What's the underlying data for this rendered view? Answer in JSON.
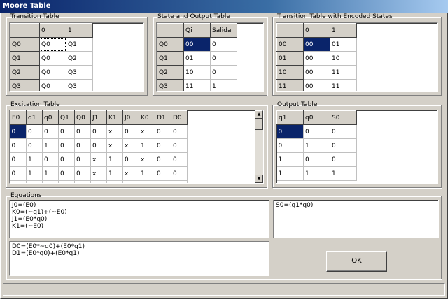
{
  "window": {
    "title": "Moore Table"
  },
  "transition_table": {
    "title": "Transition Table",
    "headers": [
      "",
      "0",
      "1"
    ],
    "rows": [
      [
        "Q0",
        "Q0",
        "Q1"
      ],
      [
        "Q1",
        "Q0",
        "Q2"
      ],
      [
        "Q2",
        "Q0",
        "Q3"
      ],
      [
        "Q3",
        "Q0",
        "Q3"
      ]
    ]
  },
  "state_output_table": {
    "title": "State and Output Table",
    "headers": [
      "",
      "Qi",
      "Salida"
    ],
    "rows": [
      [
        "Q0",
        "00",
        "0"
      ],
      [
        "Q1",
        "01",
        "0"
      ],
      [
        "Q2",
        "10",
        "0"
      ],
      [
        "Q3",
        "11",
        "1"
      ]
    ]
  },
  "encoded_table": {
    "title": "Transition Table with Encoded States",
    "headers": [
      "",
      "0",
      "1"
    ],
    "rows": [
      [
        "00",
        "00",
        "01"
      ],
      [
        "01",
        "00",
        "10"
      ],
      [
        "10",
        "00",
        "11"
      ],
      [
        "11",
        "00",
        "11"
      ]
    ]
  },
  "excitation_table": {
    "title": "Excitation Table",
    "headers": [
      "E0",
      "q1",
      "q0",
      "Q1",
      "Q0",
      "J1",
      "K1",
      "J0",
      "K0",
      "D1",
      "D0"
    ],
    "rows": [
      [
        "0",
        "0",
        "0",
        "0",
        "0",
        "0",
        "x",
        "0",
        "x",
        "0",
        "0"
      ],
      [
        "0",
        "0",
        "1",
        "0",
        "0",
        "0",
        "x",
        "x",
        "1",
        "0",
        "0"
      ],
      [
        "0",
        "1",
        "0",
        "0",
        "0",
        "x",
        "1",
        "0",
        "x",
        "0",
        "0"
      ],
      [
        "0",
        "1",
        "1",
        "0",
        "0",
        "x",
        "1",
        "x",
        "1",
        "0",
        "0"
      ],
      [
        "1",
        "0",
        "0",
        "0",
        "1",
        "0",
        "x",
        "1",
        "x",
        "0",
        "1"
      ]
    ]
  },
  "output_table": {
    "title": "Output Table",
    "headers": [
      "q1",
      "q0",
      "S0"
    ],
    "rows": [
      [
        "0",
        "0",
        "0"
      ],
      [
        "0",
        "1",
        "0"
      ],
      [
        "1",
        "0",
        "0"
      ],
      [
        "1",
        "1",
        "1"
      ]
    ]
  },
  "equations": {
    "title": "Equations",
    "jk_lines": "J0=(E0)\nK0=(~q1)+(~E0)\nJ1=(E0*q0)\nK1=(~E0)",
    "d_lines": "D0=(E0*~q0)+(E0*q1)\nD1=(E0*q0)+(E0*q1)",
    "output_lines": "S0=(q1*q0)"
  },
  "ok_button": {
    "label": "OK"
  },
  "colors": {
    "face": "#d4d0c8",
    "selection": "#0a246a",
    "title_start": "#0a246a",
    "title_end": "#a6caf0"
  }
}
